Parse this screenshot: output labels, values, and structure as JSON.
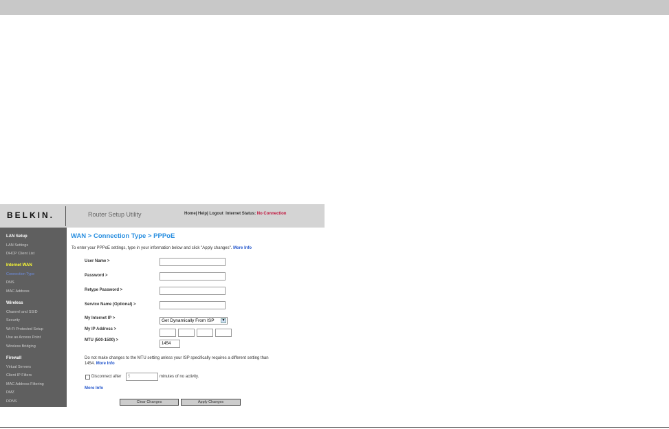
{
  "header": {
    "logo": "BELKIN.",
    "app_title": "Router Setup Utility",
    "home": "Home",
    "help": "Help",
    "logout": "Logout",
    "status_label": "Internet Status:",
    "status_value": "No Connection",
    "sep": "|"
  },
  "sidebar": {
    "sections": [
      {
        "title": "LAN Setup",
        "items": [
          "LAN Settings",
          "DHCP Client List"
        ]
      },
      {
        "title": "Internet WAN",
        "items": [
          "Connection Type",
          "DNS",
          "MAC Address"
        ]
      },
      {
        "title": "Wireless",
        "items": [
          "Channel and SSID",
          "Security",
          "Wi-Fi Protected Setup",
          "Use as Access Point",
          "Wireless Bridging"
        ]
      },
      {
        "title": "Firewall",
        "items": [
          "Virtual Servers",
          "Client IP Filters",
          "MAC Address Filtering",
          "DMZ",
          "DDNS"
        ]
      }
    ]
  },
  "main": {
    "title": "WAN > Connection Type > PPPoE",
    "intro": "To enter your PPPoE settings, type in your information below and click \"Apply changes\".",
    "more_info": "More Info",
    "fields": {
      "user_name": "User Name >",
      "password": "Password >",
      "retype_password": "Retype Password >",
      "service_name": "Service Name (Optional) >",
      "internet_ip": "My Internet IP >",
      "ip_address": "My IP Address >",
      "mtu": "MTU (500-1500) >"
    },
    "internet_ip_value": "Get Dynamically From ISP",
    "mtu_value": "1454",
    "mtu_note": "Do not make changes to the MTU setting unless your ISP specifically requires a different setting than 1454.",
    "disconnect_label": "Disconnect after",
    "disconnect_placeholder": "5",
    "disconnect_suffix": "minutes of no activity.",
    "clear_button": "Clear Changes",
    "apply_button": "Apply Changes"
  }
}
